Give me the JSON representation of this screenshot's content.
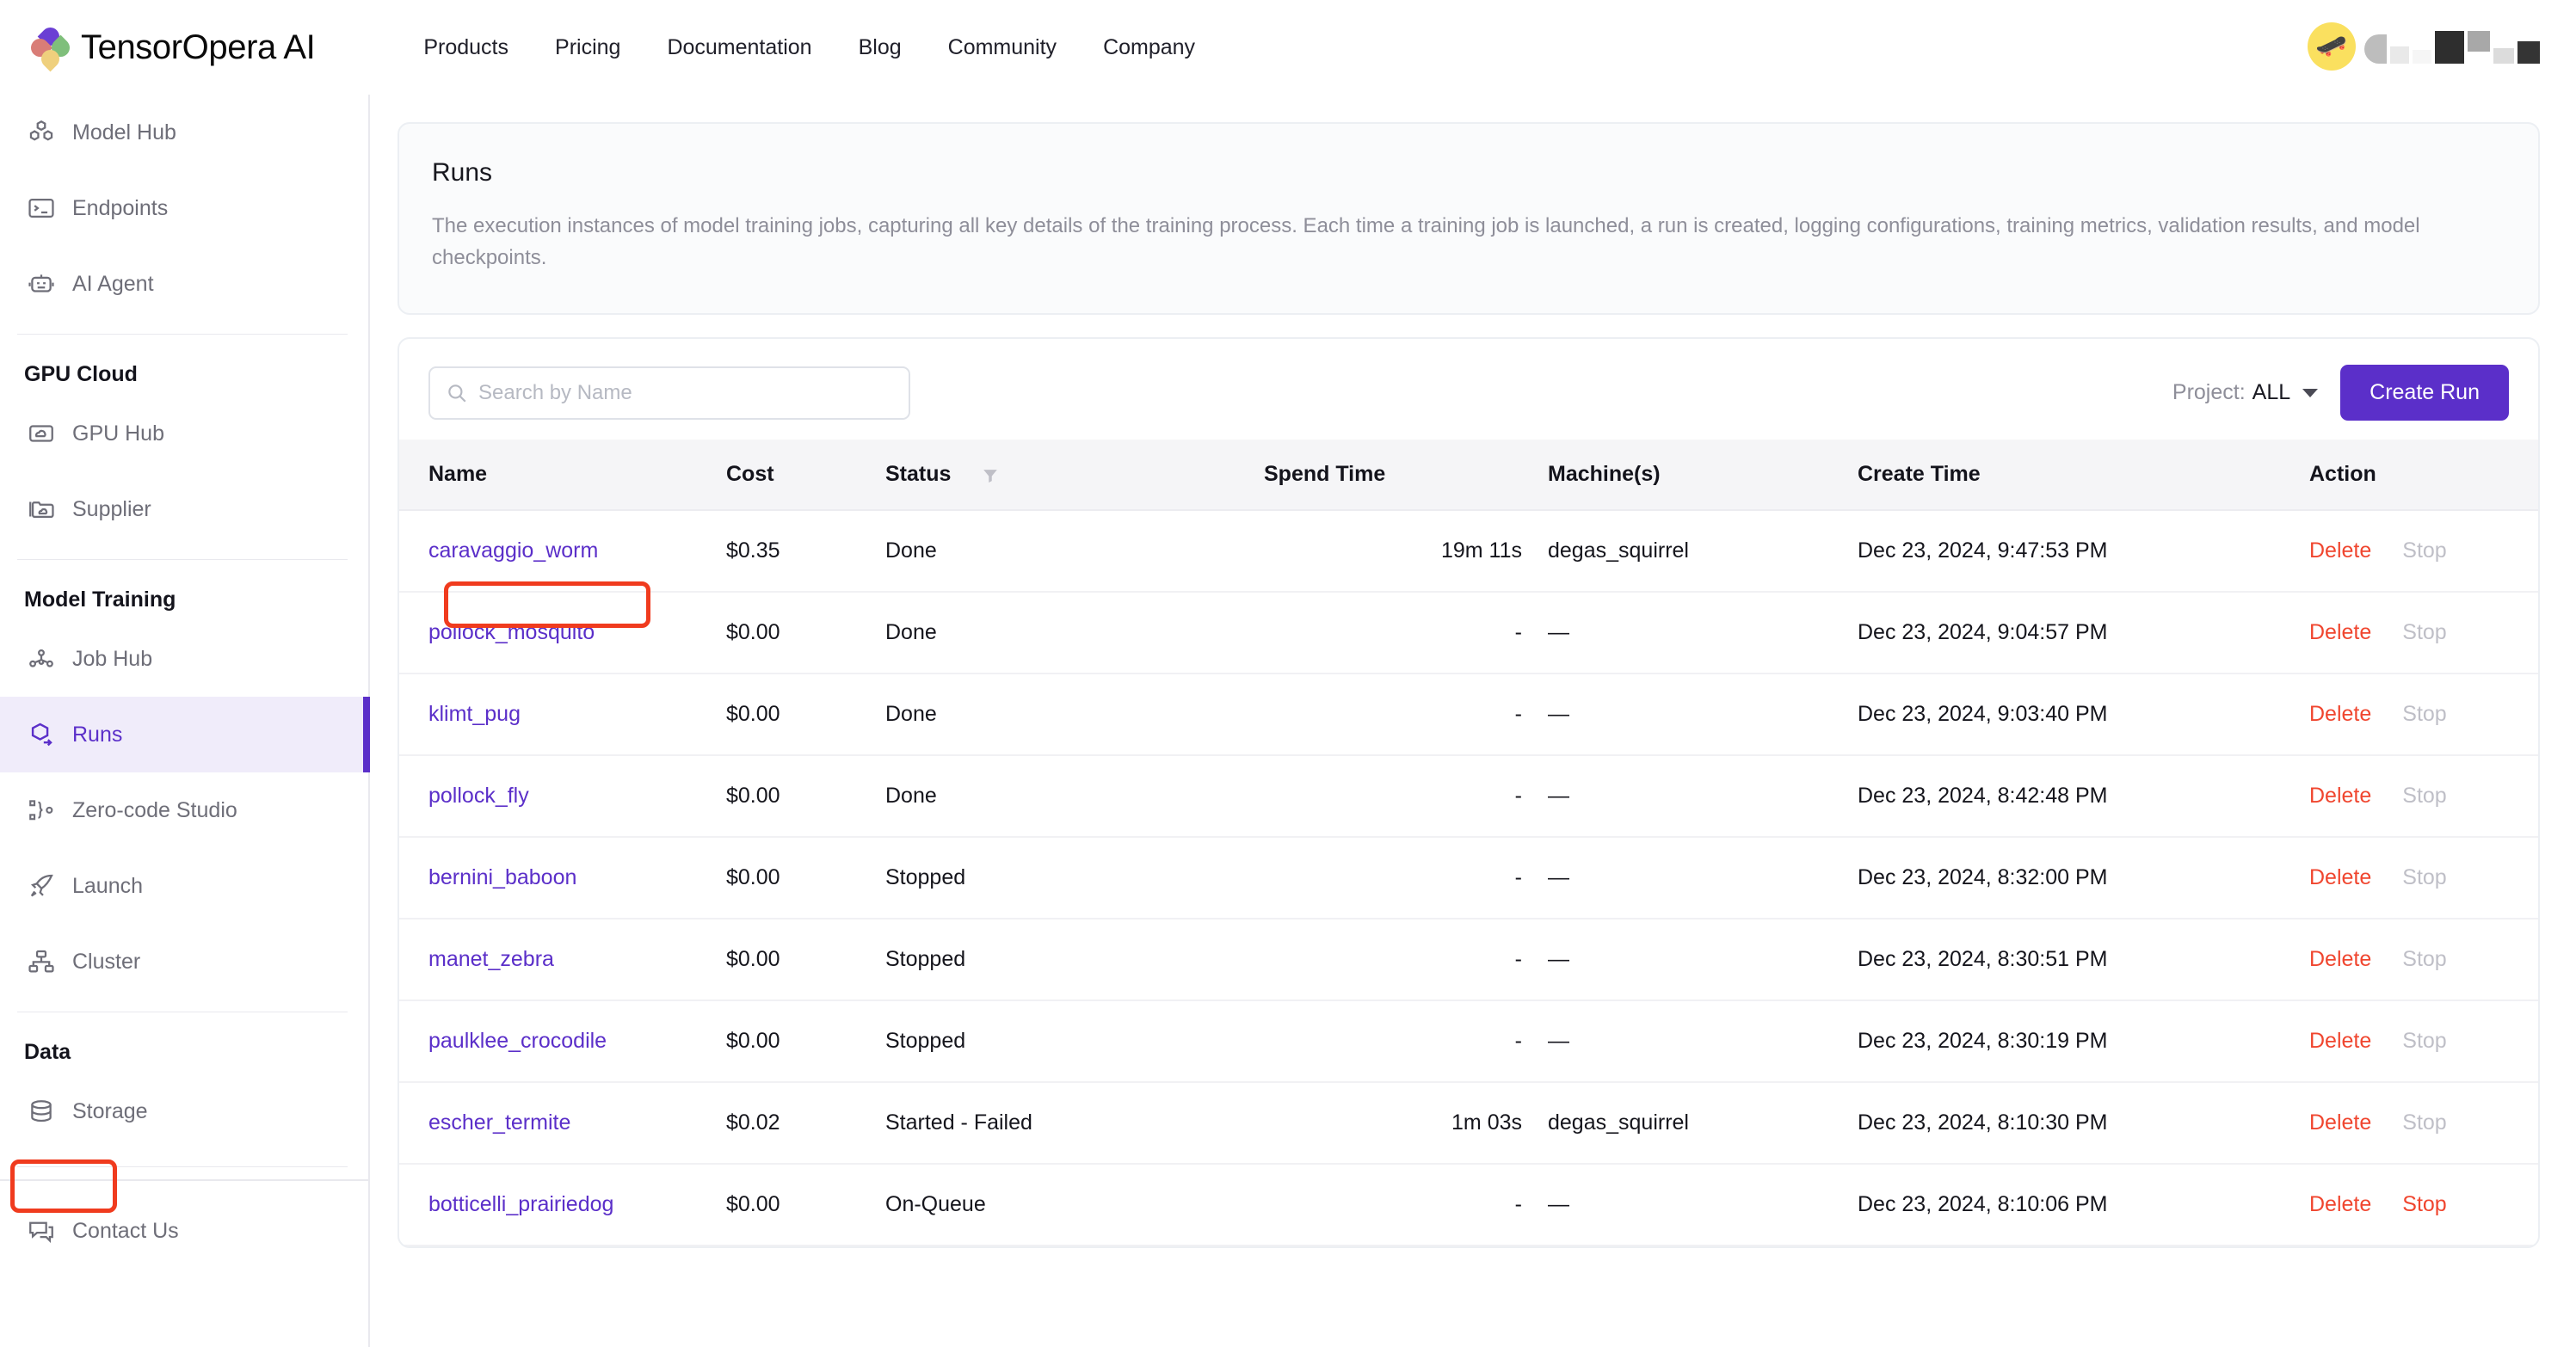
{
  "brand": {
    "name": "TensorOpera AI",
    "logo_icon": "flower-logo-icon"
  },
  "topnav": {
    "links": [
      "Products",
      "Pricing",
      "Documentation",
      "Blog",
      "Community",
      "Company"
    ],
    "avatar_emoji": "🛹"
  },
  "sidebar": {
    "items_top": [
      {
        "label": "Model Hub",
        "icon": "cubes-icon"
      },
      {
        "label": "Endpoints",
        "icon": "terminal-icon"
      },
      {
        "label": "AI Agent",
        "icon": "robot-icon"
      }
    ],
    "group_gpu": {
      "title": "GPU Cloud",
      "items": [
        {
          "label": "GPU Hub",
          "icon": "cloud-box-icon"
        },
        {
          "label": "Supplier",
          "icon": "folder-cloud-icon"
        }
      ]
    },
    "group_training": {
      "title": "Model Training",
      "items": [
        {
          "label": "Job Hub",
          "icon": "nodes-icon",
          "active": false
        },
        {
          "label": "Runs",
          "icon": "cube-arrow-icon",
          "active": true
        },
        {
          "label": "Zero-code Studio",
          "icon": "brackets-icon",
          "active": false
        },
        {
          "label": "Launch",
          "icon": "rocket-icon",
          "active": false
        },
        {
          "label": "Cluster",
          "icon": "cluster-icon",
          "active": false
        }
      ]
    },
    "group_data": {
      "title": "Data",
      "items": [
        {
          "label": "Storage",
          "icon": "database-icon"
        }
      ]
    },
    "footer": {
      "label": "Contact Us",
      "icon": "chat-icon"
    }
  },
  "header_card": {
    "title": "Runs",
    "description": "The execution instances of model training jobs, capturing all key details of the training process. Each time a training job is launched, a run is created, logging configurations, training metrics, validation results, and model checkpoints."
  },
  "toolbar": {
    "search_placeholder": "Search by Name",
    "search_value": "",
    "search_icon": "search-icon",
    "project_label": "Project:",
    "project_value": "ALL",
    "create_run_label": "Create Run"
  },
  "table": {
    "columns": [
      "Name",
      "Cost",
      "Status",
      "Spend Time",
      "Machine(s)",
      "Create Time",
      "Action"
    ],
    "status_filter_icon": "funnel-icon",
    "action_labels": {
      "delete": "Delete",
      "stop": "Stop"
    },
    "rows": [
      {
        "name": "caravaggio_worm",
        "cost": "$0.35",
        "status": "Done",
        "spend_time": "19m 11s",
        "machines": "degas_squirrel",
        "create_time": "Dec 23, 2024, 9:47:53 PM",
        "stop_enabled": false,
        "highlighted": true
      },
      {
        "name": "pollock_mosquito",
        "cost": "$0.00",
        "status": "Done",
        "spend_time": "-",
        "machines": "—",
        "create_time": "Dec 23, 2024, 9:04:57 PM",
        "stop_enabled": false,
        "highlighted": false
      },
      {
        "name": "klimt_pug",
        "cost": "$0.00",
        "status": "Done",
        "spend_time": "-",
        "machines": "—",
        "create_time": "Dec 23, 2024, 9:03:40 PM",
        "stop_enabled": false,
        "highlighted": false
      },
      {
        "name": "pollock_fly",
        "cost": "$0.00",
        "status": "Done",
        "spend_time": "-",
        "machines": "—",
        "create_time": "Dec 23, 2024, 8:42:48 PM",
        "stop_enabled": false,
        "highlighted": false
      },
      {
        "name": "bernini_baboon",
        "cost": "$0.00",
        "status": "Stopped",
        "spend_time": "-",
        "machines": "—",
        "create_time": "Dec 23, 2024, 8:32:00 PM",
        "stop_enabled": false,
        "highlighted": false
      },
      {
        "name": "manet_zebra",
        "cost": "$0.00",
        "status": "Stopped",
        "spend_time": "-",
        "machines": "—",
        "create_time": "Dec 23, 2024, 8:30:51 PM",
        "stop_enabled": false,
        "highlighted": false
      },
      {
        "name": "paulklee_crocodile",
        "cost": "$0.00",
        "status": "Stopped",
        "spend_time": "-",
        "machines": "—",
        "create_time": "Dec 23, 2024, 8:30:19 PM",
        "stop_enabled": false,
        "highlighted": false
      },
      {
        "name": "escher_termite",
        "cost": "$0.02",
        "status": "Started - Failed",
        "spend_time": "1m 03s",
        "machines": "degas_squirrel",
        "create_time": "Dec 23, 2024, 8:10:30 PM",
        "stop_enabled": false,
        "highlighted": false
      },
      {
        "name": "botticelli_prairiedog",
        "cost": "$0.00",
        "status": "On-Queue",
        "spend_time": "-",
        "machines": "—",
        "create_time": "Dec 23, 2024, 8:10:06 PM",
        "stop_enabled": true,
        "highlighted": false
      }
    ]
  },
  "colors": {
    "accent_purple": "#5b2fc9",
    "danger_red": "#f0462f",
    "annotation_red": "#f03b1e",
    "active_nav_bg": "#f0ecfa",
    "muted_text": "#8e8e99"
  },
  "annotations": [
    {
      "name": "runs-sidebar-highlight",
      "color": "#f03b1e"
    },
    {
      "name": "caravaggio-worm-link-highlight",
      "color": "#f03b1e"
    }
  ]
}
